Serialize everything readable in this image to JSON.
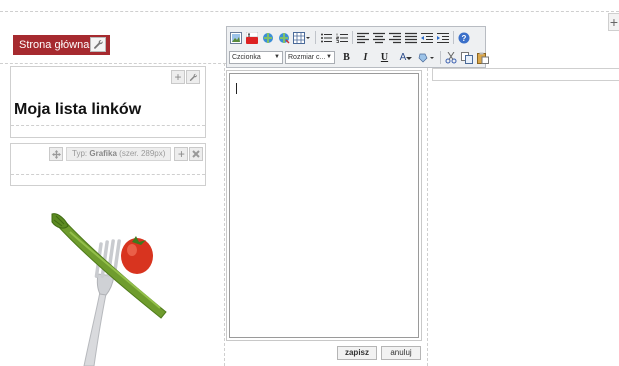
{
  "nav": {
    "home_label": "Strona główna"
  },
  "links_panel": {
    "title": "Moja lista linków"
  },
  "graphic_panel": {
    "type_prefix": "Typ:",
    "type_name": "Grafika",
    "type_size": "(szer. 289px)"
  },
  "toolbar": {
    "font_select": "Czcionka",
    "size_select": "Rozmiar c...",
    "bold": "B",
    "italic": "I",
    "underline": "U",
    "font_color": "A"
  },
  "editor": {
    "content": ""
  },
  "actions": {
    "save_label": "zapisz",
    "cancel_label": "anuluj"
  },
  "colors": {
    "brand": "#a62a2f",
    "toolbar_bg": "#eef0f2"
  }
}
